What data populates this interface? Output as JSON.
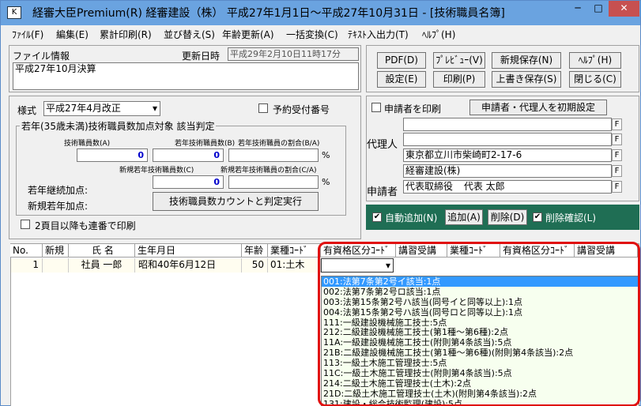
{
  "window": {
    "title": "経審大臣Premium(R)  経審建設（株）  平成27年1月1日～平成27年10月31日 - [技術職員名簿]",
    "icon_text": "K",
    "min_glyph": "─",
    "max_glyph": "□",
    "close_glyph": "✕"
  },
  "menu": [
    "ﾌｧｲﾙ(F)",
    "編集(E)",
    "累計印刷(R)",
    "並び替え(S)",
    "年齢更新(A)",
    "一括変換(C)",
    "ﾃｷｽﾄ入出力(T)",
    "ﾍﾙﾌﾟ(H)"
  ],
  "file_info": {
    "label": "ファイル情報",
    "updated_label": "更新日時",
    "updated_value": "平成29年2月10日11時17分",
    "memo": "平成27年10月決算"
  },
  "toolbar": {
    "pdf": "PDF(D)",
    "preview": "ﾌﾟﾚﾋﾞｭｰ(V)",
    "save_new": "新規保存(N)",
    "help": "ﾍﾙﾌﾟ(H)",
    "settings": "設定(E)",
    "print": "印刷(P)",
    "overwrite": "上書き保存(S)",
    "close": "閉じる(C)"
  },
  "form": {
    "style_label": "様式",
    "style_value": "平成27年4月改正",
    "reserve_label": "予約受付番号",
    "young_group_title": "若年(35歳未満)技術職員数加点対象  該当判定",
    "tech_count_label": "技術職員数(A)",
    "young_count_label": "若年技術職員数(B)",
    "ratio_label": "若年技術職員の割合(B/A)",
    "tech_count": "0",
    "young_count": "0",
    "percent": "%",
    "new_young_label": "新規若年技術職員数(C)",
    "new_ratio_label": "新規若年技術職員の割合(C/A)",
    "new_young_count": "0",
    "cont_label": "若年継続加点:",
    "new_label": "新規若年加点:",
    "judge_button": "技術職員数カウントと判定実行",
    "second_page_label": "2頁目以降も連番で印刷"
  },
  "applicant": {
    "print_label": "申請者を印刷",
    "init_button": "申請者・代理人を初期設定",
    "agent_label": "代理人",
    "applicant_label": "申請者",
    "address": "東京都立川市柴崎町2-17-6",
    "company": "経審建設(株)",
    "rep_title": "代表取締役",
    "rep_name": "代表  太郎",
    "f": "F"
  },
  "actions": {
    "auto_add": "自動追加(N)",
    "add": "追加(A)",
    "delete": "削除(D)",
    "confirm_delete": "削除確認(L)",
    "check": "✔"
  },
  "grid": {
    "columns": [
      "No.",
      "新規",
      "氏  名",
      "生年月日",
      "年齢",
      "業種ｺｰﾄﾞ",
      "有資格区分ｺｰﾄﾞ",
      "講習受講",
      "業種ｺｰﾄﾞ",
      "有資格区分ｺｰﾄﾞ",
      "講習受講"
    ],
    "row": {
      "no": "1",
      "name": "社員  一郎",
      "birth": "昭和40年6月12日",
      "age": "50",
      "industry": "01:土木"
    },
    "dropdown_arrow": "▾"
  },
  "dropdown_options": [
    "001:法第7条第2号イ該当:1点",
    "002:法第7条第2号ロ該当:1点",
    "003:法第15条第2号ハ該当(同号イと同等以上):1点",
    "004:法第15条第2号ハ該当(同号ロと同等以上):1点",
    "111:一級建設機械施工技士:5点",
    "212:二級建設機械施工技士(第1種～第6種):2点",
    "11A:一級建設機械施工技士(附則第4条該当):5点",
    "21B:二級建設機械施工技士(第1種～第6種)(附則第4条該当):2点",
    "113:一級土木施工管理技士:5点",
    "11C:一級土木施工管理技士(附則第4条該当):5点",
    "214:二級土木施工管理技士(土木):2点",
    "21D:二級土木施工管理技士(土木)(附則第4条該当):2点",
    "131:建設・総合技術監理(建設):5点"
  ],
  "selected_option_index": 0
}
